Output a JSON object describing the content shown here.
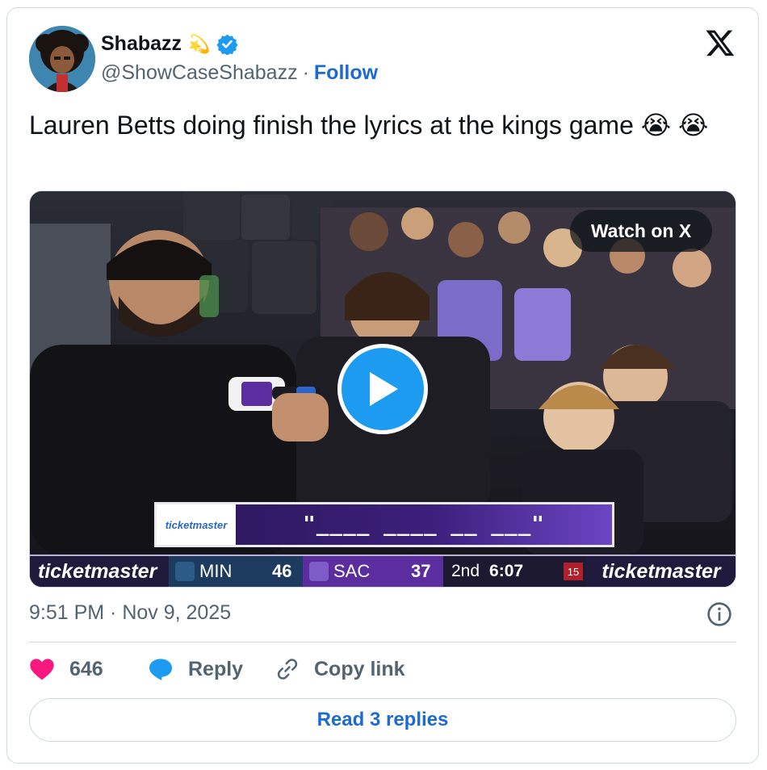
{
  "author": {
    "name": "Shabazz",
    "name_emoji": "💫",
    "handle": "@ShowCaseShabazz",
    "separator": "·",
    "follow_label": "Follow",
    "verified_color": "#1d9bf0"
  },
  "tweet": {
    "text": "Lauren Betts doing finish the lyrics at the kings game 😭 😭"
  },
  "media": {
    "watch_label": "Watch on X",
    "lyric_banner": {
      "brand": "ticketmaster",
      "blanks": "\"____ ____ __ ___\""
    },
    "scoreboard": {
      "left_brand": "ticketmaster",
      "team1": "MIN",
      "score1": "46",
      "team2": "SAC",
      "score2": "37",
      "period": "2nd",
      "clock": "6:07",
      "shot_clock": "15",
      "right_brand": "ticketmaster"
    }
  },
  "footer": {
    "timestamp": "9:51 PM · Nov 9, 2025",
    "likes": "646",
    "reply_label": "Reply",
    "copy_label": "Copy link",
    "read_replies_label": "Read 3 replies"
  },
  "colors": {
    "accent": "#1d6ad0",
    "like": "#f91880",
    "reply_icon": "#1d9bf0",
    "sac_purple": "#5b2d9e"
  },
  "icons": [
    "verified-badge-icon",
    "x-logo-icon",
    "play-icon",
    "info-icon",
    "heart-icon",
    "reply-bubble-icon",
    "link-icon"
  ]
}
